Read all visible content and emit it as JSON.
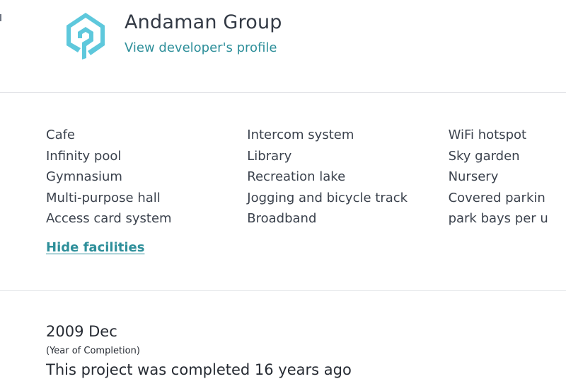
{
  "developer": {
    "name": "Andaman Group",
    "profile_link": "View developer's profile",
    "logo_icon": "developer-logo-icon",
    "brand_color": "#5ec8dc"
  },
  "facilities": {
    "columns": [
      [
        "Cafe",
        "Infinity pool",
        "Gymnasium",
        "Multi-purpose hall",
        "Access card system"
      ],
      [
        "Intercom system",
        "Library",
        "Recreation lake",
        "Jogging and bicycle track",
        "Broadband"
      ],
      [
        "WiFi hotspot",
        "Sky garden",
        "Nursery",
        "Covered parkin",
        "park bays per u"
      ]
    ],
    "hide_label": "Hide facilities"
  },
  "completion": {
    "year": "2009 Dec",
    "label": "(Year of Completion)",
    "summary": "This project was completed 16 years ago"
  },
  "colors": {
    "link": "#2e8f9a",
    "text": "#333a45",
    "divider": "#e2e4e8"
  }
}
